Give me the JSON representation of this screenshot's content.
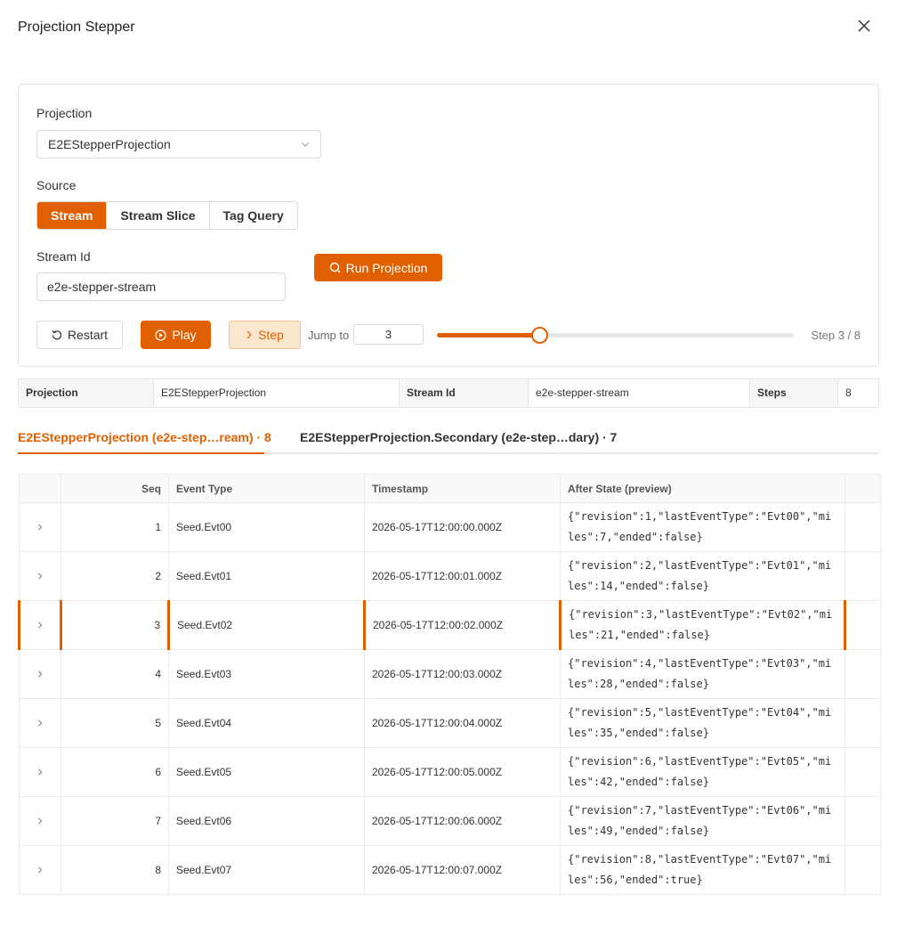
{
  "header": {
    "title": "Projection Stepper"
  },
  "form": {
    "projection_label": "Projection",
    "projection_value": "E2EStepperProjection",
    "source_label": "Source",
    "source_options": [
      "Stream",
      "Stream Slice",
      "Tag Query"
    ],
    "source_selected": "Stream",
    "stream_id_label": "Stream Id",
    "stream_id_value": "e2e-stepper-stream",
    "run_label": "Run Projection"
  },
  "controls": {
    "restart_label": "Restart",
    "play_label": "Play",
    "step_label": "Step",
    "jump_label": "Jump to",
    "jump_value": "3",
    "current_step": 3,
    "total_steps": 8,
    "step_text": "Step 3 / 8"
  },
  "summary": {
    "projection_key": "Projection",
    "projection_value": "E2EStepperProjection",
    "stream_key": "Stream Id",
    "stream_value": "e2e-stepper-stream",
    "steps_key": "Steps",
    "steps_value": "8"
  },
  "tabs": [
    {
      "label": "E2EStepperProjection (e2e-step…ream) · 8"
    },
    {
      "label": "E2EStepperProjection.Secondary (e2e-step…dary) · 7"
    }
  ],
  "table": {
    "headers": [
      "",
      "Seq",
      "Event Type",
      "Timestamp",
      "After State (preview)",
      ""
    ],
    "rows": [
      {
        "seq": "1",
        "type": "Seed.Evt00",
        "ts": "2026-05-17T12:00:00.000Z",
        "state": "{\"revision\":1,\"lastEventType\":\"Evt00\",\"miles\":7,\"ended\":false}"
      },
      {
        "seq": "2",
        "type": "Seed.Evt01",
        "ts": "2026-05-17T12:00:01.000Z",
        "state": "{\"revision\":2,\"lastEventType\":\"Evt01\",\"miles\":14,\"ended\":false}"
      },
      {
        "seq": "3",
        "type": "Seed.Evt02",
        "ts": "2026-05-17T12:00:02.000Z",
        "state": "{\"revision\":3,\"lastEventType\":\"Evt02\",\"miles\":21,\"ended\":false}"
      },
      {
        "seq": "4",
        "type": "Seed.Evt03",
        "ts": "2026-05-17T12:00:03.000Z",
        "state": "{\"revision\":4,\"lastEventType\":\"Evt03\",\"miles\":28,\"ended\":false}"
      },
      {
        "seq": "5",
        "type": "Seed.Evt04",
        "ts": "2026-05-17T12:00:04.000Z",
        "state": "{\"revision\":5,\"lastEventType\":\"Evt04\",\"miles\":35,\"ended\":false}"
      },
      {
        "seq": "6",
        "type": "Seed.Evt05",
        "ts": "2026-05-17T12:00:05.000Z",
        "state": "{\"revision\":6,\"lastEventType\":\"Evt05\",\"miles\":42,\"ended\":false}"
      },
      {
        "seq": "7",
        "type": "Seed.Evt06",
        "ts": "2026-05-17T12:00:06.000Z",
        "state": "{\"revision\":7,\"lastEventType\":\"Evt06\",\"miles\":49,\"ended\":false}"
      },
      {
        "seq": "8",
        "type": "Seed.Evt07",
        "ts": "2026-05-17T12:00:07.000Z",
        "state": "{\"revision\":8,\"lastEventType\":\"Evt07\",\"miles\":56,\"ended\":true}"
      }
    ]
  },
  "icons": {
    "close": "close-icon",
    "dropdown": "chevron-down-icon",
    "run": "search-icon",
    "restart": "restart-icon",
    "play": "play-icon",
    "step": "chevron-right-icon",
    "expand": "chevron-right-icon"
  },
  "colors": {
    "accent": "#e06000",
    "accent_soft": "#fbe6cf"
  }
}
